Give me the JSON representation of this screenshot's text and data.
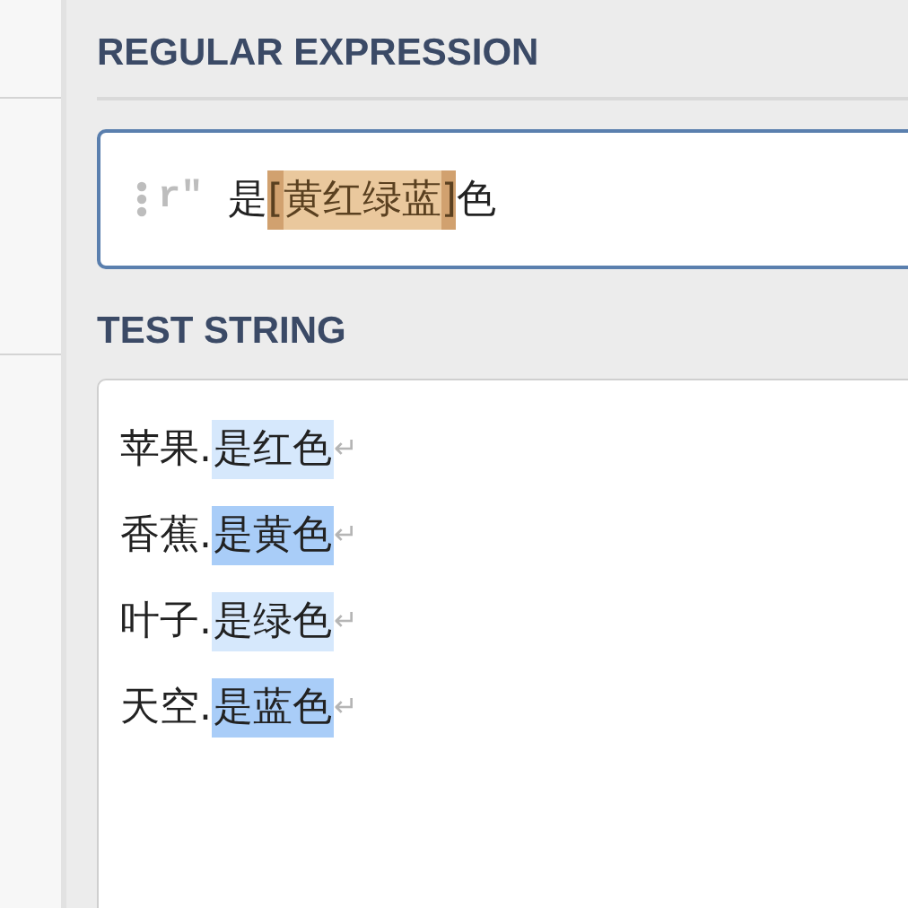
{
  "regex_section": {
    "heading": "REGULAR EXPRESSION",
    "flag": "r\"",
    "tokens": [
      {
        "text": "是",
        "kind": "literal"
      },
      {
        "text": "[",
        "kind": "bracket"
      },
      {
        "text": "黄红绿蓝",
        "kind": "set"
      },
      {
        "text": "]",
        "kind": "bracket"
      },
      {
        "text": "色",
        "kind": "literal"
      }
    ]
  },
  "test_section": {
    "heading": "TEST STRING",
    "lines": [
      {
        "prefix": "苹果.",
        "match": "是红色",
        "color": "#d6e8fc",
        "line_end": "↵"
      },
      {
        "prefix": "香蕉.",
        "match": "是黄色",
        "color": "#a9cdf8",
        "line_end": "↵"
      },
      {
        "prefix": "叶子.",
        "match": "是绿色",
        "color": "#d6e8fc",
        "line_end": "↵"
      },
      {
        "prefix": "天空.",
        "match": "是蓝色",
        "color": "#a9cdf8",
        "line_end": "↵"
      }
    ]
  }
}
